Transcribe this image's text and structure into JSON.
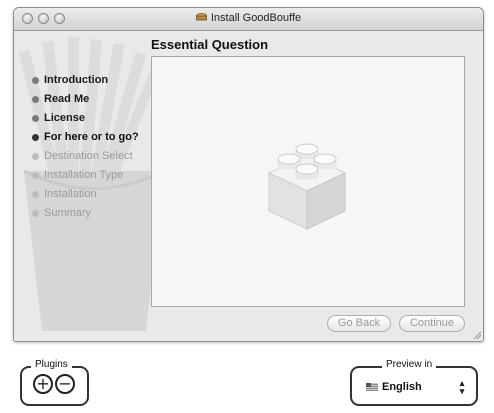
{
  "window": {
    "title": "Install GoodBouffe",
    "heading": "Essential Question"
  },
  "steps": [
    {
      "label": "Introduction",
      "state": "done"
    },
    {
      "label": "Read Me",
      "state": "done"
    },
    {
      "label": "License",
      "state": "done"
    },
    {
      "label": "For here or to go?",
      "state": "current"
    },
    {
      "label": "Destination Select",
      "state": "pending"
    },
    {
      "label": "Installation Type",
      "state": "pending"
    },
    {
      "label": "Installation",
      "state": "pending"
    },
    {
      "label": "Summary",
      "state": "pending"
    }
  ],
  "buttons": {
    "back": "Go Back",
    "continue": "Continue"
  },
  "plugins": {
    "label": "Plugins",
    "add_symbol": "+",
    "remove_symbol": "−"
  },
  "preview": {
    "label": "Preview in",
    "language": "English",
    "stepper_symbol": "⬍"
  },
  "icons": {
    "title_icon": "package-icon",
    "panel_icon": "bundle-block-icon",
    "flag_icon": "us-flag-icon"
  }
}
